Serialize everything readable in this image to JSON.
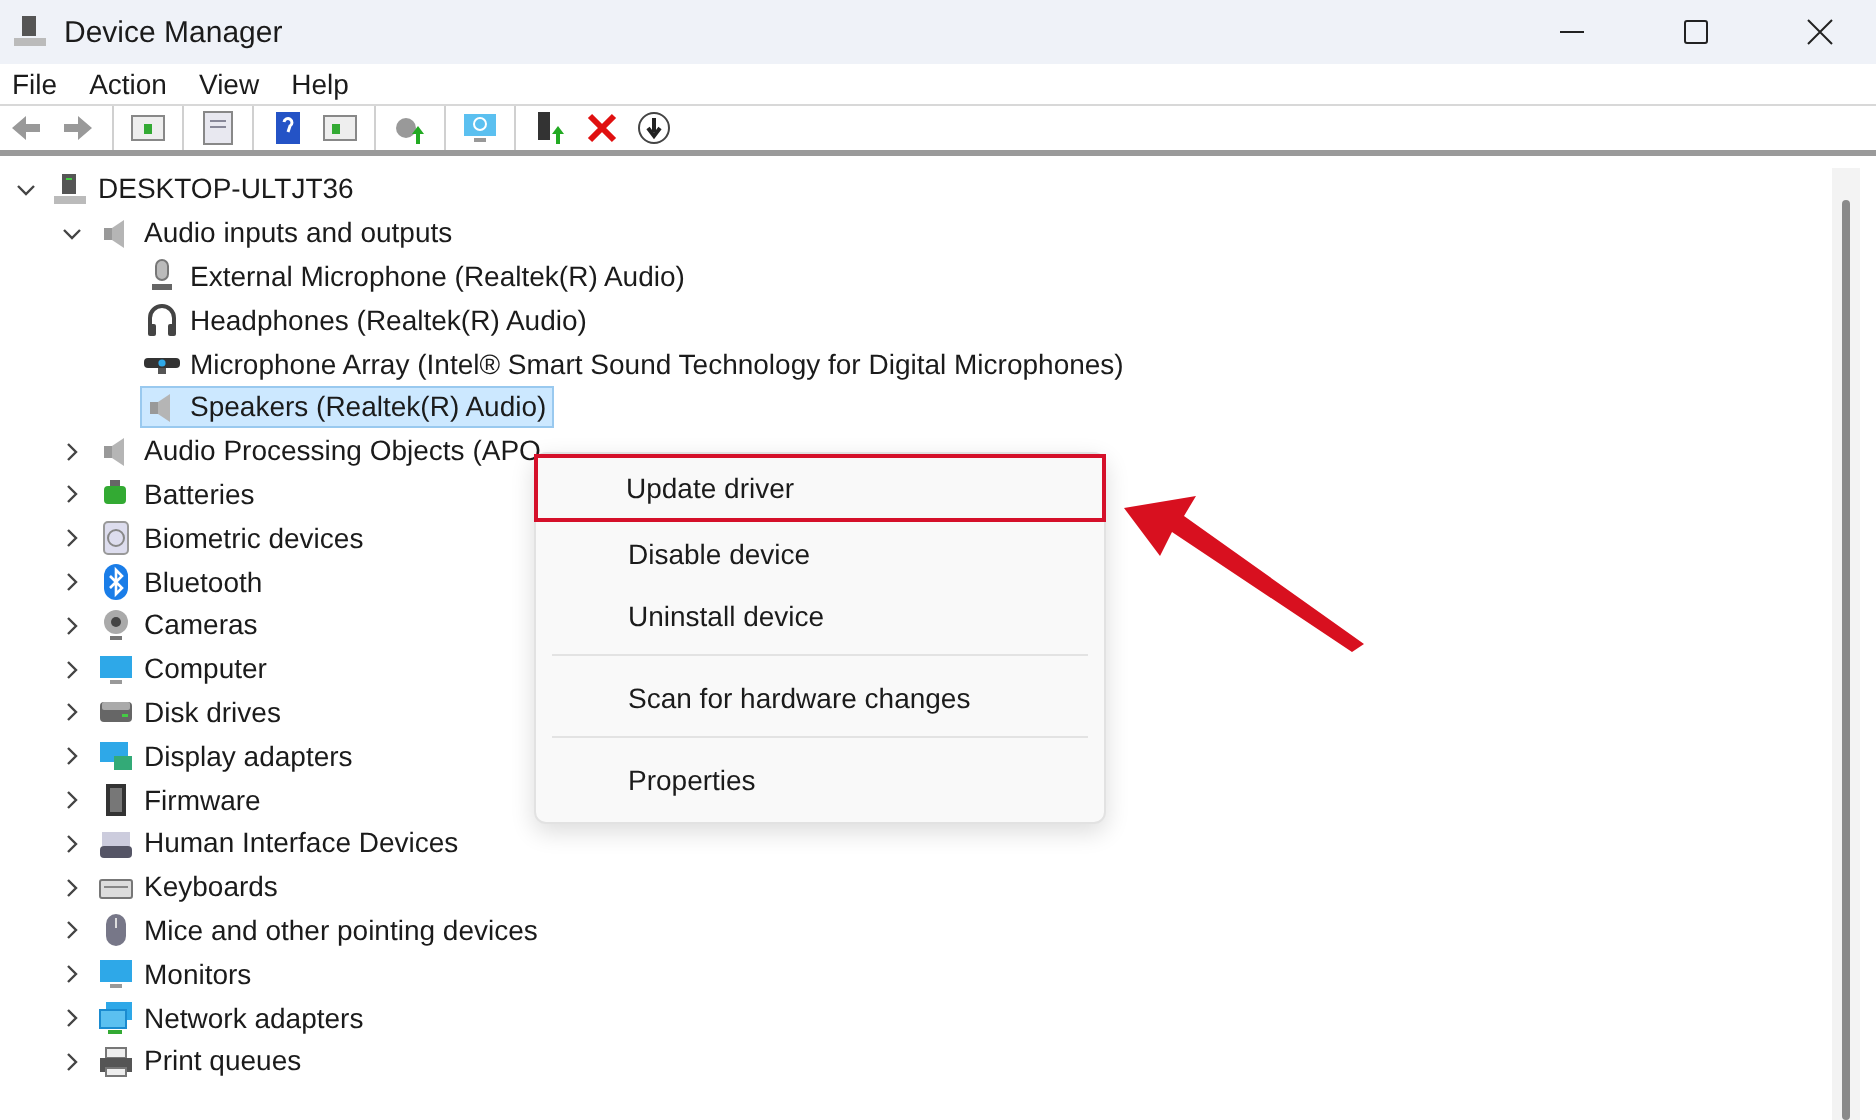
{
  "window": {
    "title": "Device Manager"
  },
  "menu_bar": [
    "File",
    "Action",
    "View",
    "Help"
  ],
  "tree": {
    "label": "DESKTOP-ULTJT36",
    "expanded": true,
    "selected": false,
    "children": [
      {
        "label": "Audio inputs and outputs",
        "expanded": true,
        "selected": false,
        "children": [
          {
            "label": "External Microphone (Realtek(R) Audio)",
            "selected": false
          },
          {
            "label": "Headphones (Realtek(R) Audio)",
            "selected": false
          },
          {
            "label": "Microphone Array (Intel® Smart Sound Technology for Digital Microphones)",
            "selected": false
          },
          {
            "label": "Speakers (Realtek(R) Audio)",
            "selected": true
          }
        ]
      },
      {
        "label": "Audio Processing Objects (APO",
        "expanded": false,
        "selected": false
      },
      {
        "label": "Batteries",
        "expanded": false,
        "selected": false
      },
      {
        "label": "Biometric devices",
        "expanded": false,
        "selected": false
      },
      {
        "label": "Bluetooth",
        "expanded": false,
        "selected": false
      },
      {
        "label": "Cameras",
        "expanded": false,
        "selected": false
      },
      {
        "label": "Computer",
        "expanded": false,
        "selected": false
      },
      {
        "label": "Disk drives",
        "expanded": false,
        "selected": false
      },
      {
        "label": "Display adapters",
        "expanded": false,
        "selected": false
      },
      {
        "label": "Firmware",
        "expanded": false,
        "selected": false
      },
      {
        "label": "Human Interface Devices",
        "expanded": false,
        "selected": false
      },
      {
        "label": "Keyboards",
        "expanded": false,
        "selected": false
      },
      {
        "label": "Mice and other pointing devices",
        "expanded": false,
        "selected": false
      },
      {
        "label": "Monitors",
        "expanded": false,
        "selected": false
      },
      {
        "label": "Network adapters",
        "expanded": false,
        "selected": false
      },
      {
        "label": "Print queues",
        "expanded": false,
        "selected": false
      }
    ]
  },
  "context_menu": {
    "items": [
      {
        "kind": "item",
        "label": "Update driver",
        "highlighted": true
      },
      {
        "kind": "item",
        "label": "Disable device",
        "highlighted": false
      },
      {
        "kind": "item",
        "label": "Uninstall device",
        "highlighted": false
      },
      {
        "kind": "separator"
      },
      {
        "kind": "item",
        "label": "Scan for hardware changes",
        "highlighted": false
      },
      {
        "kind": "separator"
      },
      {
        "kind": "item",
        "label": "Properties",
        "highlighted": false
      }
    ]
  }
}
